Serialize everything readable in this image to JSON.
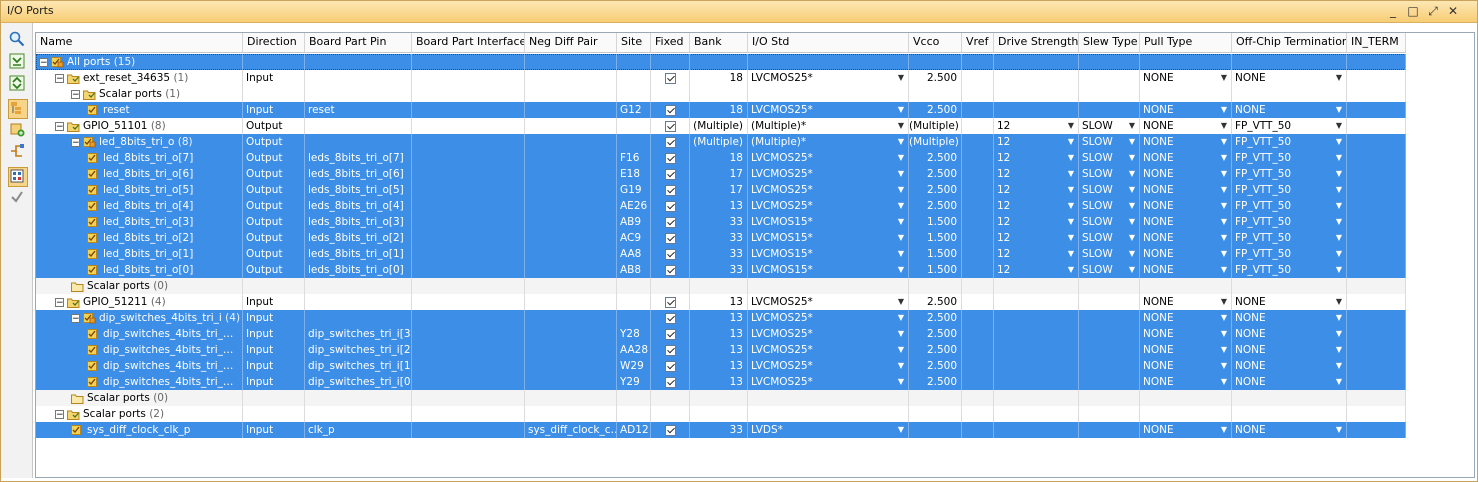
{
  "window": {
    "title": "I/O Ports",
    "controls": [
      "_",
      "□",
      "⤢",
      "✕"
    ]
  },
  "toolbar": {
    "icons": [
      "search-icon",
      "collapse-all-icon",
      "expand-all-icon",
      "group-by-interface-icon",
      "create-port-icon",
      "create-interface-icon",
      "auto-place-icon",
      "check-icon"
    ]
  },
  "columns": [
    "Name",
    "Direction",
    "Board Part Pin",
    "Board Part Interface",
    "Neg Diff Pair",
    "Site",
    "Fixed",
    "Bank",
    "I/O Std",
    "Vcco",
    "Vref",
    "Drive Strength",
    "Slew Type",
    "Pull Type",
    "Off-Chip Termination",
    "IN_TERM"
  ],
  "rows": [
    {
      "level": 0,
      "exp": "−",
      "icon": "bus",
      "name": "All ports",
      "count": "(15)",
      "sel": true,
      "top": true
    },
    {
      "level": 1,
      "exp": "−",
      "icon": "folder",
      "name": "ext_reset_34635",
      "count": "(1)",
      "dir": "Input",
      "fixed": true,
      "bank": "18",
      "iostd": "LVCMOS25*",
      "iostd_dd": true,
      "vcco": "2.500",
      "pull": "NONE",
      "pull_dd": true,
      "term": "NONE",
      "term_dd": true
    },
    {
      "level": 2,
      "exp": "−",
      "icon": "folder",
      "name": "Scalar ports",
      "count": "(1)"
    },
    {
      "level": 3,
      "icon": "port",
      "name": "reset",
      "sel": true,
      "dir": "Input",
      "pin": "reset",
      "site": "G12",
      "fixed": true,
      "bank": "18",
      "iostd": "LVCMOS25*",
      "iostd_dd": true,
      "vcco": "2.500",
      "pull": "NONE",
      "pull_dd": true,
      "term": "NONE",
      "term_dd": true
    },
    {
      "level": 1,
      "exp": "−",
      "icon": "folder",
      "name": "GPIO_51101",
      "count": "(8)",
      "dir": "Output",
      "fixed": true,
      "bank": "(Multiple)",
      "iostd": "(Multiple)*",
      "iostd_dd": true,
      "vcco": "(Multiple)",
      "drive": "12",
      "drive_dd": true,
      "slew": "SLOW",
      "slew_dd": true,
      "pull": "NONE",
      "pull_dd": true,
      "term": "FP_VTT_50",
      "term_dd": true
    },
    {
      "level": 2,
      "exp": "−",
      "icon": "bus",
      "name": "led_8bits_tri_o",
      "count": "(8)",
      "sel": true,
      "dir": "Output",
      "fixed": true,
      "bank": "(Multiple)",
      "iostd": "(Multiple)*",
      "iostd_dd": true,
      "vcco": "(Multiple)",
      "drive": "12",
      "drive_dd": true,
      "slew": "SLOW",
      "slew_dd": true,
      "pull": "NONE",
      "pull_dd": true,
      "term": "FP_VTT_50",
      "term_dd": true
    },
    {
      "level": 3,
      "icon": "port",
      "name": "led_8bits_tri_o[7]",
      "sel": true,
      "dir": "Output",
      "pin": "leds_8bits_tri_o[7]",
      "site": "F16",
      "fixed": true,
      "bank": "18",
      "iostd": "LVCMOS25*",
      "iostd_dd": true,
      "vcco": "2.500",
      "drive": "12",
      "drive_dd": true,
      "slew": "SLOW",
      "slew_dd": true,
      "pull": "NONE",
      "pull_dd": true,
      "term": "FP_VTT_50",
      "term_dd": true
    },
    {
      "level": 3,
      "icon": "port",
      "name": "led_8bits_tri_o[6]",
      "sel": true,
      "dir": "Output",
      "pin": "leds_8bits_tri_o[6]",
      "site": "E18",
      "fixed": true,
      "bank": "17",
      "iostd": "LVCMOS25*",
      "iostd_dd": true,
      "vcco": "2.500",
      "drive": "12",
      "drive_dd": true,
      "slew": "SLOW",
      "slew_dd": true,
      "pull": "NONE",
      "pull_dd": true,
      "term": "FP_VTT_50",
      "term_dd": true
    },
    {
      "level": 3,
      "icon": "port",
      "name": "led_8bits_tri_o[5]",
      "sel": true,
      "dir": "Output",
      "pin": "leds_8bits_tri_o[5]",
      "site": "G19",
      "fixed": true,
      "bank": "17",
      "iostd": "LVCMOS25*",
      "iostd_dd": true,
      "vcco": "2.500",
      "drive": "12",
      "drive_dd": true,
      "slew": "SLOW",
      "slew_dd": true,
      "pull": "NONE",
      "pull_dd": true,
      "term": "FP_VTT_50",
      "term_dd": true
    },
    {
      "level": 3,
      "icon": "port",
      "name": "led_8bits_tri_o[4]",
      "sel": true,
      "dir": "Output",
      "pin": "leds_8bits_tri_o[4]",
      "site": "AE26",
      "fixed": true,
      "bank": "13",
      "iostd": "LVCMOS25*",
      "iostd_dd": true,
      "vcco": "2.500",
      "drive": "12",
      "drive_dd": true,
      "slew": "SLOW",
      "slew_dd": true,
      "pull": "NONE",
      "pull_dd": true,
      "term": "FP_VTT_50",
      "term_dd": true
    },
    {
      "level": 3,
      "icon": "port",
      "name": "led_8bits_tri_o[3]",
      "sel": true,
      "dir": "Output",
      "pin": "leds_8bits_tri_o[3]",
      "site": "AB9",
      "fixed": true,
      "bank": "33",
      "iostd": "LVCMOS15*",
      "iostd_dd": true,
      "vcco": "1.500",
      "drive": "12",
      "drive_dd": true,
      "slew": "SLOW",
      "slew_dd": true,
      "pull": "NONE",
      "pull_dd": true,
      "term": "FP_VTT_50",
      "term_dd": true
    },
    {
      "level": 3,
      "icon": "port",
      "name": "led_8bits_tri_o[2]",
      "sel": true,
      "dir": "Output",
      "pin": "leds_8bits_tri_o[2]",
      "site": "AC9",
      "fixed": true,
      "bank": "33",
      "iostd": "LVCMOS15*",
      "iostd_dd": true,
      "vcco": "1.500",
      "drive": "12",
      "drive_dd": true,
      "slew": "SLOW",
      "slew_dd": true,
      "pull": "NONE",
      "pull_dd": true,
      "term": "FP_VTT_50",
      "term_dd": true
    },
    {
      "level": 3,
      "icon": "port",
      "name": "led_8bits_tri_o[1]",
      "sel": true,
      "dir": "Output",
      "pin": "leds_8bits_tri_o[1]",
      "site": "AA8",
      "fixed": true,
      "bank": "33",
      "iostd": "LVCMOS15*",
      "iostd_dd": true,
      "vcco": "1.500",
      "drive": "12",
      "drive_dd": true,
      "slew": "SLOW",
      "slew_dd": true,
      "pull": "NONE",
      "pull_dd": true,
      "term": "FP_VTT_50",
      "term_dd": true
    },
    {
      "level": 3,
      "icon": "port",
      "name": "led_8bits_tri_o[0]",
      "sel": true,
      "dir": "Output",
      "pin": "leds_8bits_tri_o[0]",
      "site": "AB8",
      "fixed": true,
      "bank": "33",
      "iostd": "LVCMOS15*",
      "iostd_dd": true,
      "vcco": "1.500",
      "drive": "12",
      "drive_dd": true,
      "slew": "SLOW",
      "slew_dd": true,
      "pull": "NONE",
      "pull_dd": true,
      "term": "FP_VTT_50",
      "term_dd": true
    },
    {
      "level": 2,
      "icon": "folder-empty",
      "name": "Scalar ports",
      "count": "(0)",
      "plain": true
    },
    {
      "level": 1,
      "exp": "−",
      "icon": "folder",
      "name": "GPIO_51211",
      "count": "(4)",
      "dir": "Input",
      "fixed": true,
      "bank": "13",
      "iostd": "LVCMOS25*",
      "iostd_dd": true,
      "vcco": "2.500",
      "pull": "NONE",
      "pull_dd": true,
      "term": "NONE",
      "term_dd": true
    },
    {
      "level": 2,
      "exp": "−",
      "icon": "bus",
      "name": "dip_switches_4bits_tri_i",
      "count": "(4)",
      "sel": true,
      "dir": "Input",
      "fixed": true,
      "bank": "13",
      "iostd": "LVCMOS25*",
      "iostd_dd": true,
      "vcco": "2.500",
      "pull": "NONE",
      "pull_dd": true,
      "term": "NONE",
      "term_dd": true
    },
    {
      "level": 3,
      "icon": "port",
      "name": "dip_switches_4bits_tri_…",
      "sel": true,
      "dir": "Input",
      "pin": "dip_switches_tri_i[3]",
      "site": "Y28",
      "fixed": true,
      "bank": "13",
      "iostd": "LVCMOS25*",
      "iostd_dd": true,
      "vcco": "2.500",
      "pull": "NONE",
      "pull_dd": true,
      "term": "NONE",
      "term_dd": true
    },
    {
      "level": 3,
      "icon": "port",
      "name": "dip_switches_4bits_tri_…",
      "sel": true,
      "dir": "Input",
      "pin": "dip_switches_tri_i[2]",
      "site": "AA28",
      "fixed": true,
      "bank": "13",
      "iostd": "LVCMOS25*",
      "iostd_dd": true,
      "vcco": "2.500",
      "pull": "NONE",
      "pull_dd": true,
      "term": "NONE",
      "term_dd": true
    },
    {
      "level": 3,
      "icon": "port",
      "name": "dip_switches_4bits_tri_…",
      "sel": true,
      "dir": "Input",
      "pin": "dip_switches_tri_i[1]",
      "site": "W29",
      "fixed": true,
      "bank": "13",
      "iostd": "LVCMOS25*",
      "iostd_dd": true,
      "vcco": "2.500",
      "pull": "NONE",
      "pull_dd": true,
      "term": "NONE",
      "term_dd": true
    },
    {
      "level": 3,
      "icon": "port",
      "name": "dip_switches_4bits_tri_…",
      "sel": true,
      "dir": "Input",
      "pin": "dip_switches_tri_i[0]",
      "site": "Y29",
      "fixed": true,
      "bank": "13",
      "iostd": "LVCMOS25*",
      "iostd_dd": true,
      "vcco": "2.500",
      "pull": "NONE",
      "pull_dd": true,
      "term": "NONE",
      "term_dd": true
    },
    {
      "level": 2,
      "icon": "folder-empty",
      "name": "Scalar ports",
      "count": "(0)",
      "plain": true
    },
    {
      "level": 1,
      "exp": "−",
      "icon": "folder",
      "name": "Scalar ports",
      "count": "(2)"
    },
    {
      "level": 2,
      "icon": "port",
      "name": "sys_diff_clock_clk_p",
      "sel": true,
      "dir": "Input",
      "pin": "clk_p",
      "neg": "sys_diff_clock_c…",
      "site": "AD12",
      "fixed": true,
      "bank": "33",
      "iostd": "LVDS*",
      "iostd_dd": true,
      "pull": "NONE",
      "pull_dd": true,
      "term": "NONE",
      "term_dd": true
    }
  ],
  "colors": {
    "selection": "#3d8ee6",
    "titlebar": "#f7cd74",
    "header": "#fafafa"
  }
}
